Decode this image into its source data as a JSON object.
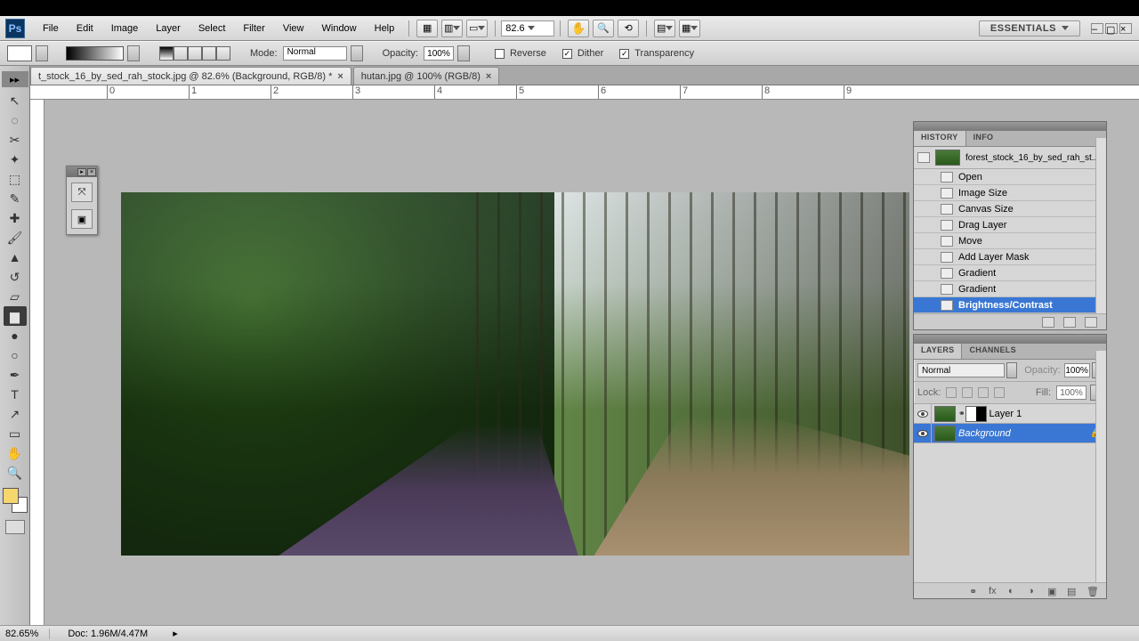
{
  "menubar": {
    "items": [
      "File",
      "Edit",
      "Image",
      "Layer",
      "Select",
      "Filter",
      "View",
      "Window",
      "Help"
    ],
    "zoom": "82.6",
    "workspace": "ESSENTIALS"
  },
  "optionsbar": {
    "mode_label": "Mode:",
    "mode_value": "Normal",
    "opacity_label": "Opacity:",
    "opacity_value": "100%",
    "reverse": "Reverse",
    "dither": "Dither",
    "transparency": "Transparency"
  },
  "tabs": [
    {
      "label": "t_stock_16_by_sed_rah_stock.jpg @ 82.6% (Background, RGB/8) *",
      "active": true
    },
    {
      "label": "hutan.jpg @ 100% (RGB/8)",
      "active": false
    }
  ],
  "history_panel": {
    "tabs": [
      "HISTORY",
      "INFO"
    ],
    "source": "forest_stock_16_by_sed_rah_st...",
    "items": [
      "Open",
      "Image Size",
      "Canvas Size",
      "Drag Layer",
      "Move",
      "Add Layer Mask",
      "Gradient",
      "Gradient",
      "Brightness/Contrast"
    ],
    "selected_index": 8
  },
  "layers_panel": {
    "tabs": [
      "LAYERS",
      "CHANNELS"
    ],
    "blend": "Normal",
    "opacity_label": "Opacity:",
    "opacity_value": "100%",
    "lock_label": "Lock:",
    "fill_label": "Fill:",
    "fill_value": "100%",
    "layers": [
      {
        "name": "Layer 1",
        "has_mask": true,
        "selected": false,
        "locked": false
      },
      {
        "name": "Background",
        "has_mask": false,
        "selected": true,
        "locked": true
      }
    ]
  },
  "statusbar": {
    "zoom": "82.65%",
    "doc": "Doc: 1.96M/4.47M"
  },
  "colors": {
    "fg": "#f5d76e",
    "bg": "#ffffff",
    "select": "#3a77d4"
  }
}
